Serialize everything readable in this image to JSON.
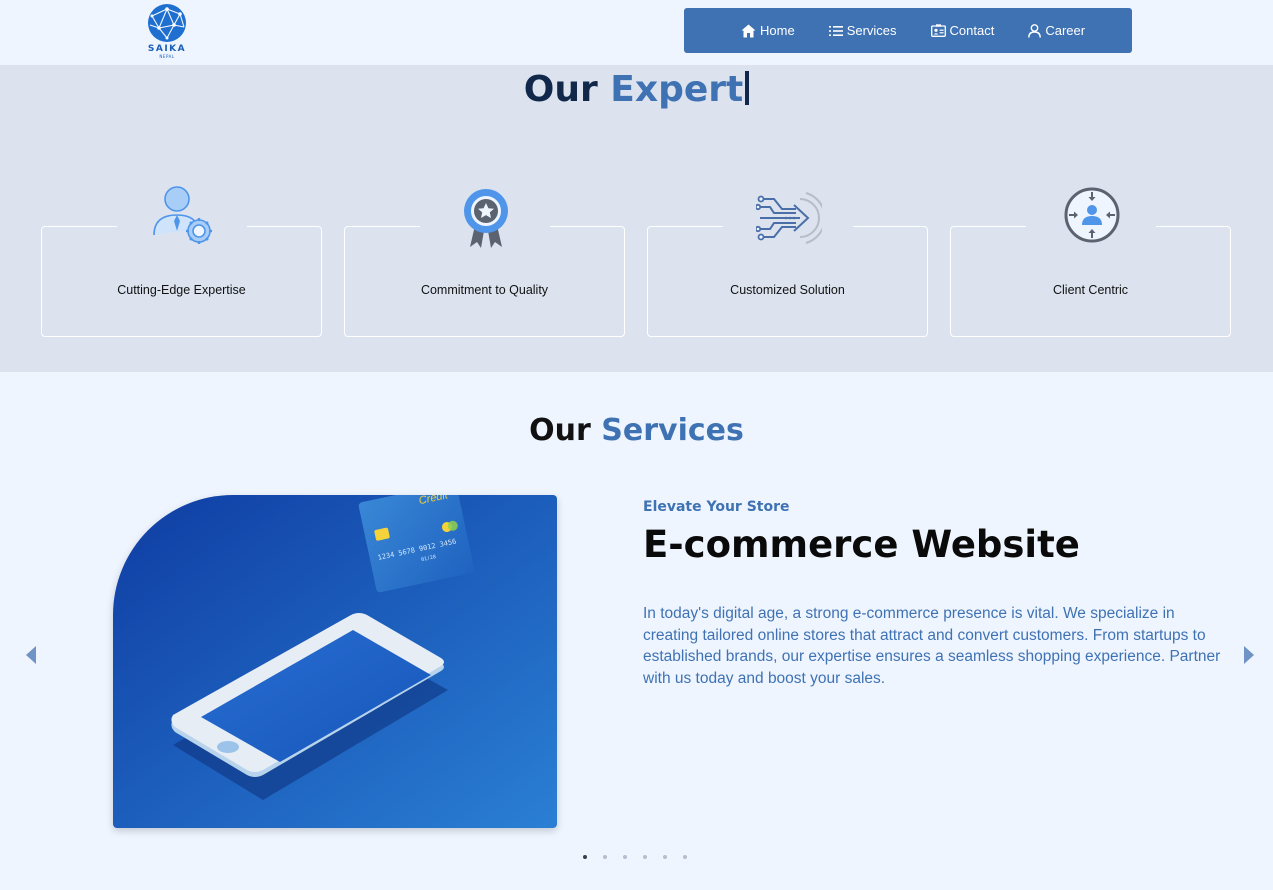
{
  "brand": {
    "name": "SAIKA",
    "tagline": "NEPAL"
  },
  "nav": {
    "items": [
      {
        "label": "Home",
        "icon": "home-icon"
      },
      {
        "label": "Services",
        "icon": "list-icon"
      },
      {
        "label": "Contact",
        "icon": "contact-card-icon"
      },
      {
        "label": "Career",
        "icon": "user-icon"
      }
    ]
  },
  "expert": {
    "title_prefix": "Our",
    "title_accent": "Expert",
    "cards": [
      {
        "label": "Cutting-Edge Expertise",
        "icon": "expert-badge-icon"
      },
      {
        "label": "Commitment to Quality",
        "icon": "award-ribbon-icon"
      },
      {
        "label": "Customized Solution",
        "icon": "circuit-arrow-icon"
      },
      {
        "label": "Client Centric",
        "icon": "client-focus-icon"
      }
    ]
  },
  "services": {
    "title_prefix": "Our",
    "title_accent": "Services",
    "slide": {
      "subtitle": "Elevate Your Store",
      "heading": "E-commerce Website",
      "description": "In today's digital age, a strong e-commerce presence is vital. We specialize in creating tailored online stores that attract and convert customers. From startups to established brands, our expertise ensures a seamless shopping experience. Partner with us today and boost your sales.",
      "card_text": "Credit",
      "card_number": "1234 5678 9012 3456",
      "card_expiry": "01/28"
    },
    "slide_count": 6,
    "active_slide": 1
  },
  "colors": {
    "accent": "#3f72b3",
    "nav_bg": "#3f72b3",
    "section_bg": "#dce3ef",
    "page_bg": "#eef5ff",
    "title_dark": "#11284b"
  }
}
